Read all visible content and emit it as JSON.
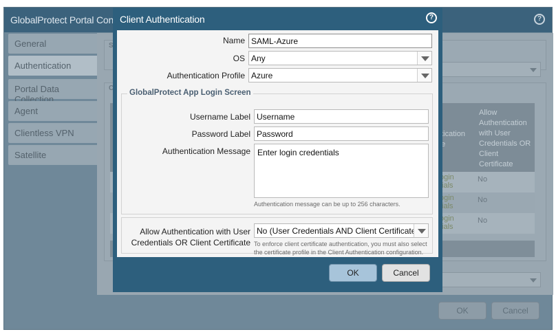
{
  "background": {
    "title": "GlobalProtect Portal Configuration",
    "tabs": [
      {
        "label": "General"
      },
      {
        "label": "Authentication"
      },
      {
        "label": "Portal Data Collection"
      },
      {
        "label": "Agent"
      },
      {
        "label": "Clientless VPN"
      },
      {
        "label": "Satellite"
      }
    ],
    "partial_labels": {
      "section_s": "S",
      "section_c": "C"
    },
    "table": {
      "column_partial": "ntication\nge",
      "column_allow": "Allow\nAuthentication\nwith User\nCredentials OR\nClient\nCertificate",
      "rows": [
        {
          "message": "ogin\ntials",
          "allow": "No"
        },
        {
          "message": "ogin\ntials",
          "allow": "No"
        },
        {
          "message": "ogin\ntials",
          "allow": "No"
        }
      ]
    },
    "ok_label": "OK",
    "cancel_label": "Cancel"
  },
  "modal": {
    "title": "Client Authentication",
    "name_label": "Name",
    "name_value": "SAML-Azure",
    "os_label": "OS",
    "os_value": "Any",
    "auth_profile_label": "Authentication Profile",
    "auth_profile_value": "Azure",
    "login_screen_legend": "GlobalProtect App Login Screen",
    "username_label_label": "Username Label",
    "username_label_value": "Username",
    "password_label_label": "Password Label",
    "password_label_value": "Password",
    "auth_message_label": "Authentication Message",
    "auth_message_value": "Enter login credentials",
    "auth_message_hint": "Authentication message can be up to 256 characters.",
    "allow_auth_label": "Allow Authentication with User Credentials OR Client Certificate",
    "allow_auth_value": "No (User Credentials AND Client Certificate Required)",
    "allow_auth_hint": "To enforce client certificate authentication, you must also select the certificate profile in the Client Authentication configuration.",
    "ok_label": "OK",
    "cancel_label": "Cancel"
  },
  "colors": {
    "header": "#2d5f7d",
    "primary_button": "#a7c4da",
    "legend_text": "#4a5f72"
  }
}
